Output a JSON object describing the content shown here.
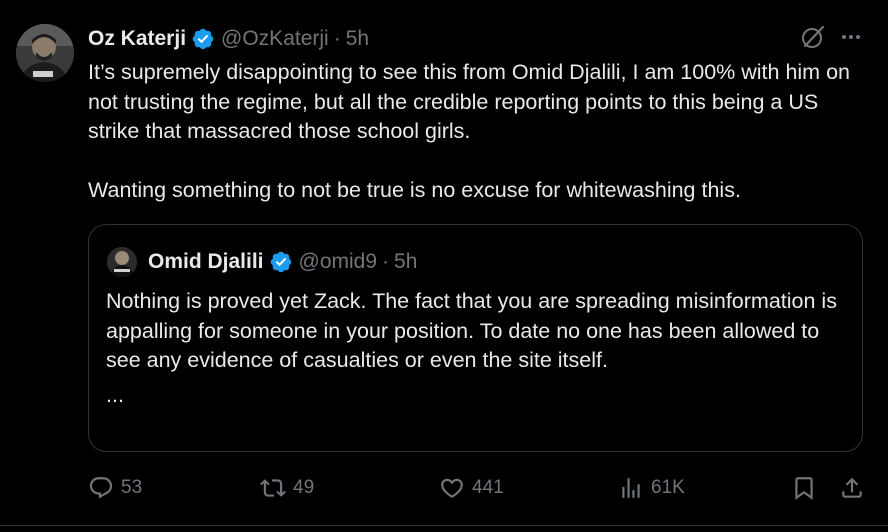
{
  "tweet": {
    "author_name": "Oz Katerji",
    "author_handle": "@OzKaterji",
    "separator": "·",
    "time": "5h",
    "paragraph_1": "It’s supremely disappointing to see this from Omid Djalili, I am 100% with him on not trusting the regime, but all the credible reporting points to this being a US strike that massacred those school girls.",
    "paragraph_2": "Wanting something to not be true is no excuse for whitewashing this."
  },
  "quote": {
    "author_name": "Omid Djalili",
    "author_handle": "@omid9",
    "separator": "·",
    "time": "5h",
    "body": "Nothing is proved yet Zack. The fact that you are spreading misinformation is appalling for someone in your position. To date no one has been allowed to see any evidence of casualties or even the site itself.",
    "ellipsis": "..."
  },
  "actions": {
    "replies": "53",
    "reposts": "49",
    "likes": "441",
    "views": "61K"
  },
  "colors": {
    "background": "#000000",
    "text": "#e7e9ea",
    "muted": "#71767b",
    "border": "#2f3336",
    "verified": "#1d9bf0"
  },
  "icons": [
    "grok-icon",
    "more-icon",
    "verified-icon",
    "reply-icon",
    "repost-icon",
    "like-icon",
    "views-icon",
    "bookmark-icon",
    "share-icon"
  ]
}
